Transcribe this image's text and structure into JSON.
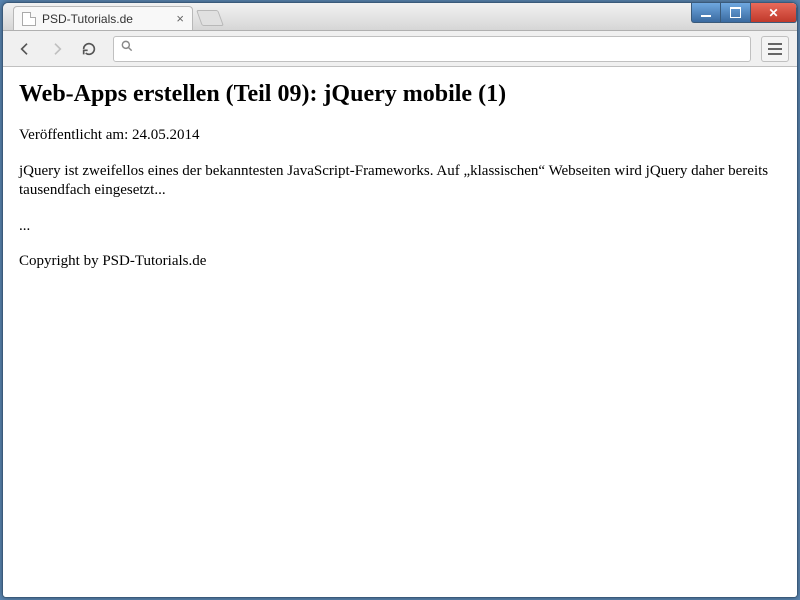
{
  "window": {
    "tab_title": "PSD-Tutorials.de"
  },
  "toolbar": {
    "url_value": ""
  },
  "page": {
    "heading": "Web-Apps erstellen (Teil 09): jQuery mobile (1)",
    "published": "Veröffentlicht am: 24.05.2014",
    "intro": "jQuery ist zweifellos eines der bekanntesten JavaScript-Frameworks. Auf „klassischen“ Webseiten wird jQuery daher bereits tausendfach eingesetzt...",
    "ellipsis": "...",
    "copyright": "Copyright by PSD-Tutorials.de"
  }
}
